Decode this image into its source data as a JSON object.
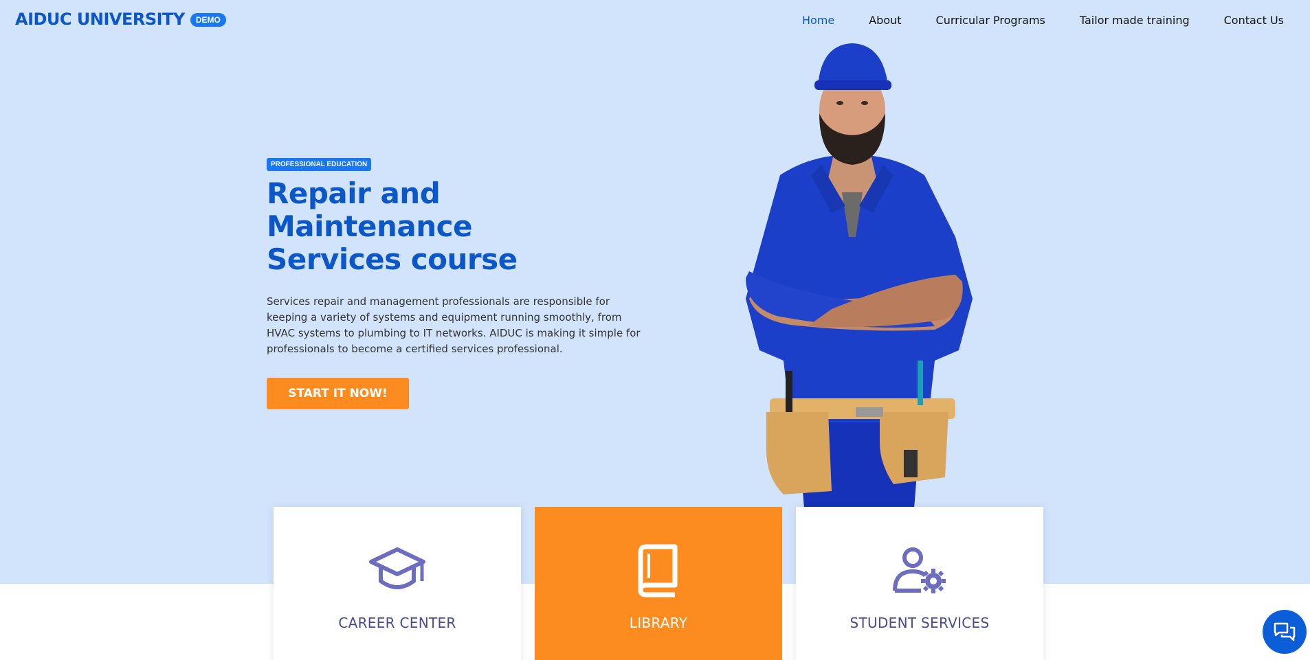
{
  "header": {
    "logo_text": "AIDUC UNIVERSITY",
    "demo_badge": "DEMO",
    "nav": [
      {
        "label": "Home",
        "active": true
      },
      {
        "label": "About"
      },
      {
        "label": "Curricular Programs"
      },
      {
        "label": "Tailor made training"
      },
      {
        "label": "Contact Us"
      }
    ]
  },
  "hero": {
    "eyebrow": "PROFESSIONAL EDUCATION",
    "title": "Repair and Maintenance Services course",
    "description": "Services repair and management professionals are responsible for keeping a variety of systems and equipment running smoothly, from HVAC systems to plumbing to IT networks. AIDUC is making it simple for professionals to become a certified services professional.",
    "cta_label": "START IT NOW!"
  },
  "cards": [
    {
      "label": "CAREER CENTER",
      "icon": "graduation-cap-icon"
    },
    {
      "label": "LIBRARY",
      "icon": "book-icon"
    },
    {
      "label": "STUDENT SERVICES",
      "icon": "user-gear-icon"
    }
  ],
  "colors": {
    "hero_bg": "#d2e3fc",
    "brand_blue": "#0b57c9",
    "badge_blue": "#1877f2",
    "accent_orange": "#fc8c1f",
    "card_text": "#4a4a8f"
  }
}
